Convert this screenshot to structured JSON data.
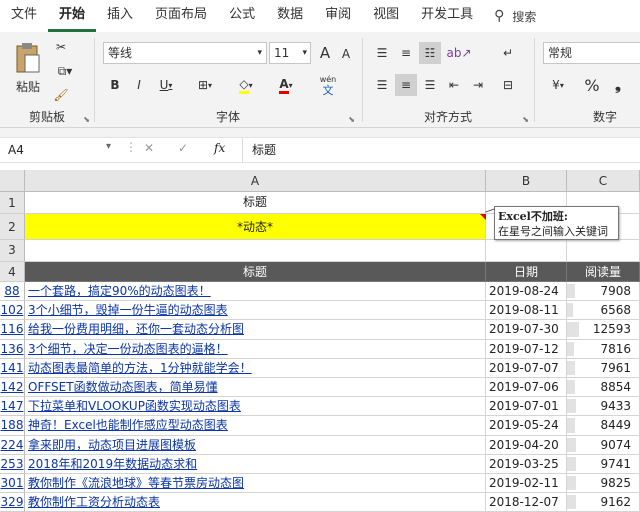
{
  "tabs": [
    "文件",
    "开始",
    "插入",
    "页面布局",
    "公式",
    "数据",
    "审阅",
    "视图",
    "开发工具"
  ],
  "search_label": "搜索",
  "ribbon": {
    "clipboard": {
      "paste": "粘贴",
      "label": "剪贴板"
    },
    "font": {
      "name": "等线",
      "size": "11",
      "label": "字体",
      "grow": "A",
      "shrink": "A",
      "bold": "B",
      "italic": "I",
      "underline": "U",
      "font_color": "A",
      "phonetic_top": "wén",
      "phonetic_bottom": "文"
    },
    "align": {
      "label": "对齐方式"
    },
    "number": {
      "format": "常规",
      "label": "数字",
      "currency": "¥",
      "percent": "%"
    }
  },
  "formula_bar": {
    "name_box": "A4",
    "fx": "fx",
    "value": "标题"
  },
  "columns": [
    "A",
    "B",
    "C"
  ],
  "sheet": {
    "row1": {
      "num": "1",
      "a": "标题"
    },
    "row2": {
      "num": "2",
      "a": "*动态*"
    },
    "row3": {
      "num": "3"
    },
    "header": {
      "num": "4",
      "a": "标题",
      "b": "日期",
      "c": "阅读量"
    }
  },
  "comment": {
    "title": "Excel不加班:",
    "body": "在星号之间输入关键词"
  },
  "rows": [
    {
      "num": "88",
      "title": "一个套路，搞定90%的动态图表！",
      "date": "2019-08-24",
      "reads": "7908",
      "bar": 0.63
    },
    {
      "num": "102",
      "title": "3个小细节，毁掉一份牛逼的动态图表",
      "date": "2019-08-11",
      "reads": "6568",
      "bar": 0.52
    },
    {
      "num": "116",
      "title": "给我一份费用明细，还你一套动态分析图",
      "date": "2019-07-30",
      "reads": "12593",
      "bar": 1.0
    },
    {
      "num": "136",
      "title": "3个细节，决定一份动态图表的逼格！",
      "date": "2019-07-12",
      "reads": "7816",
      "bar": 0.62
    },
    {
      "num": "141",
      "title": "动态图表最简单的方法，1分钟就能学会！",
      "date": "2019-07-07",
      "reads": "7961",
      "bar": 0.63
    },
    {
      "num": "142",
      "title": "OFFSET函数做动态图表，简单易懂",
      "date": "2019-07-06",
      "reads": "8854",
      "bar": 0.7
    },
    {
      "num": "147",
      "title": "下拉菜单和VLOOKUP函数实现动态图表",
      "date": "2019-07-01",
      "reads": "9433",
      "bar": 0.75
    },
    {
      "num": "188",
      "title": "神奇！Excel也能制作感应型动态图表",
      "date": "2019-05-24",
      "reads": "8449",
      "bar": 0.67
    },
    {
      "num": "224",
      "title": "拿来即用，动态项目进展图模板",
      "date": "2019-04-20",
      "reads": "9074",
      "bar": 0.72
    },
    {
      "num": "253",
      "title": "2018年和2019年数据动态求和",
      "date": "2019-03-25",
      "reads": "9741",
      "bar": 0.77
    },
    {
      "num": "301",
      "title": "教你制作《流浪地球》等春节票房动态图",
      "date": "2019-02-11",
      "reads": "9825",
      "bar": 0.78
    },
    {
      "num": "329",
      "title": "教你制作工资分析动态表",
      "date": "2018-12-07",
      "reads": "9162",
      "bar": 0.73
    }
  ]
}
